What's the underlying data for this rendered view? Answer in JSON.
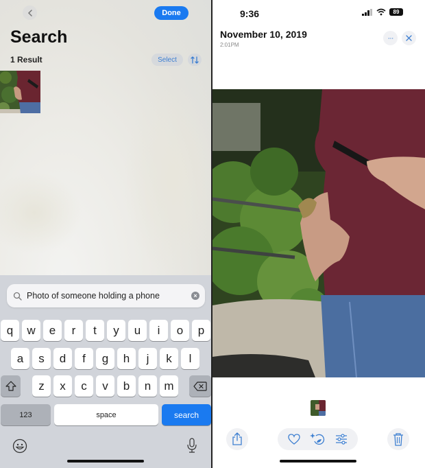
{
  "search_screen": {
    "title": "Search",
    "done_label": "Done",
    "result_count": "1 Result",
    "select_label": "Select",
    "query": "Photo of someone holding a phone",
    "icons": {
      "back": "chevron-left-icon",
      "sort": "sort-arrows-icon",
      "search": "magnifier-icon",
      "clear": "clear-x-icon"
    }
  },
  "keyboard": {
    "row1": [
      "q",
      "w",
      "e",
      "r",
      "t",
      "y",
      "u",
      "i",
      "o",
      "p"
    ],
    "row2": [
      "a",
      "s",
      "d",
      "f",
      "g",
      "h",
      "j",
      "k",
      "l"
    ],
    "row3": [
      "z",
      "x",
      "c",
      "v",
      "b",
      "n",
      "m"
    ],
    "numbers_label": "123",
    "space_label": "space",
    "search_label": "search",
    "icons": {
      "shift": "shift-icon",
      "delete": "backspace-icon",
      "emoji": "emoji-icon",
      "mic": "microphone-icon"
    }
  },
  "status_bar": {
    "time": "9:36",
    "battery": "89"
  },
  "photo_viewer": {
    "date": "November 10, 2019",
    "time": "2:01PM",
    "photo_description": "Person in maroon t-shirt and jeans holding a phone, butterfly on wrist, green plants in background",
    "toolbar": [
      "share",
      "favorite",
      "visual-look-up",
      "edit-adjust",
      "delete"
    ]
  },
  "colors": {
    "accent": "#1a7af0",
    "icon_blue": "#3d7fd1",
    "keyboard_bg": "#d1d4da"
  }
}
